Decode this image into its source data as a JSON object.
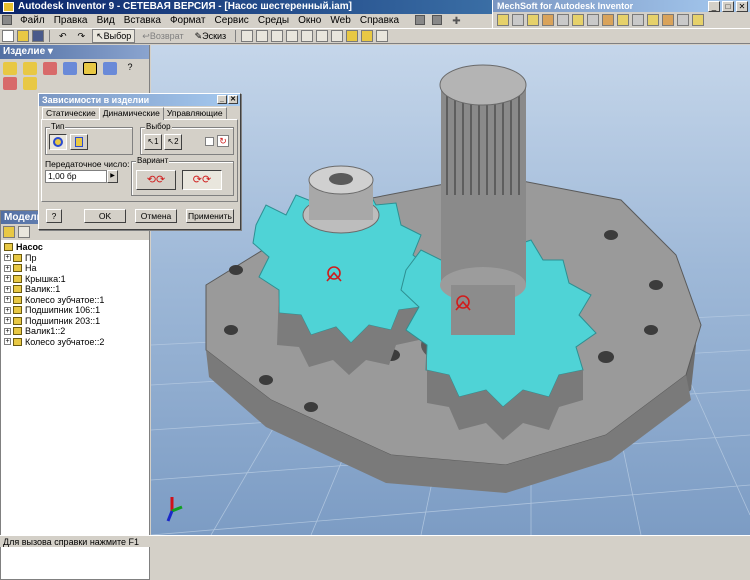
{
  "window": {
    "title": "Autodesk Inventor 9 - СЕТЕВАЯ ВЕРСИЯ - [Насос шестеренный.iam]",
    "mechsoft_title": "MechSoft for Autodesk Inventor"
  },
  "menu": [
    "Файл",
    "Правка",
    "Вид",
    "Вставка",
    "Формат",
    "Сервис",
    "Среды",
    "Окно",
    "Web",
    "Справка"
  ],
  "toolbar": {
    "select_label": "Выбор",
    "return_label": "Возврат",
    "sketch_label": "Эскиз"
  },
  "panel": {
    "title": "Изделие",
    "model_title": "Модель"
  },
  "tree": {
    "root": "Насос",
    "items": [
      "Пр",
      "На",
      "Крышка:1",
      "Валик::1",
      "Колесо зубчатое::1",
      "Подшипник 106::1",
      "Подшипник 203::1",
      "Валик1::2",
      "Колесо зубчатое::2"
    ]
  },
  "dialog": {
    "title": "Зависимости в изделии",
    "tabs": [
      "Статические",
      "Динамические",
      "Управляющие"
    ],
    "type_label": "Тип",
    "select_label": "Выбор",
    "select1": "1",
    "select2": "2",
    "ratio_label": "Передаточное число:",
    "ratio_value": "1,00 бр",
    "variant_label": "Вариант",
    "help": "?",
    "ok": "OK",
    "cancel": "Отмена",
    "apply": "Применить"
  },
  "status": {
    "text": "Для вызова справки нажмите F1"
  },
  "colors": {
    "title_bar": "#0a246a",
    "gear_face": "#4fd3d6",
    "part_gray": "#8c8c8c",
    "background_top": "#c5d6ea"
  }
}
